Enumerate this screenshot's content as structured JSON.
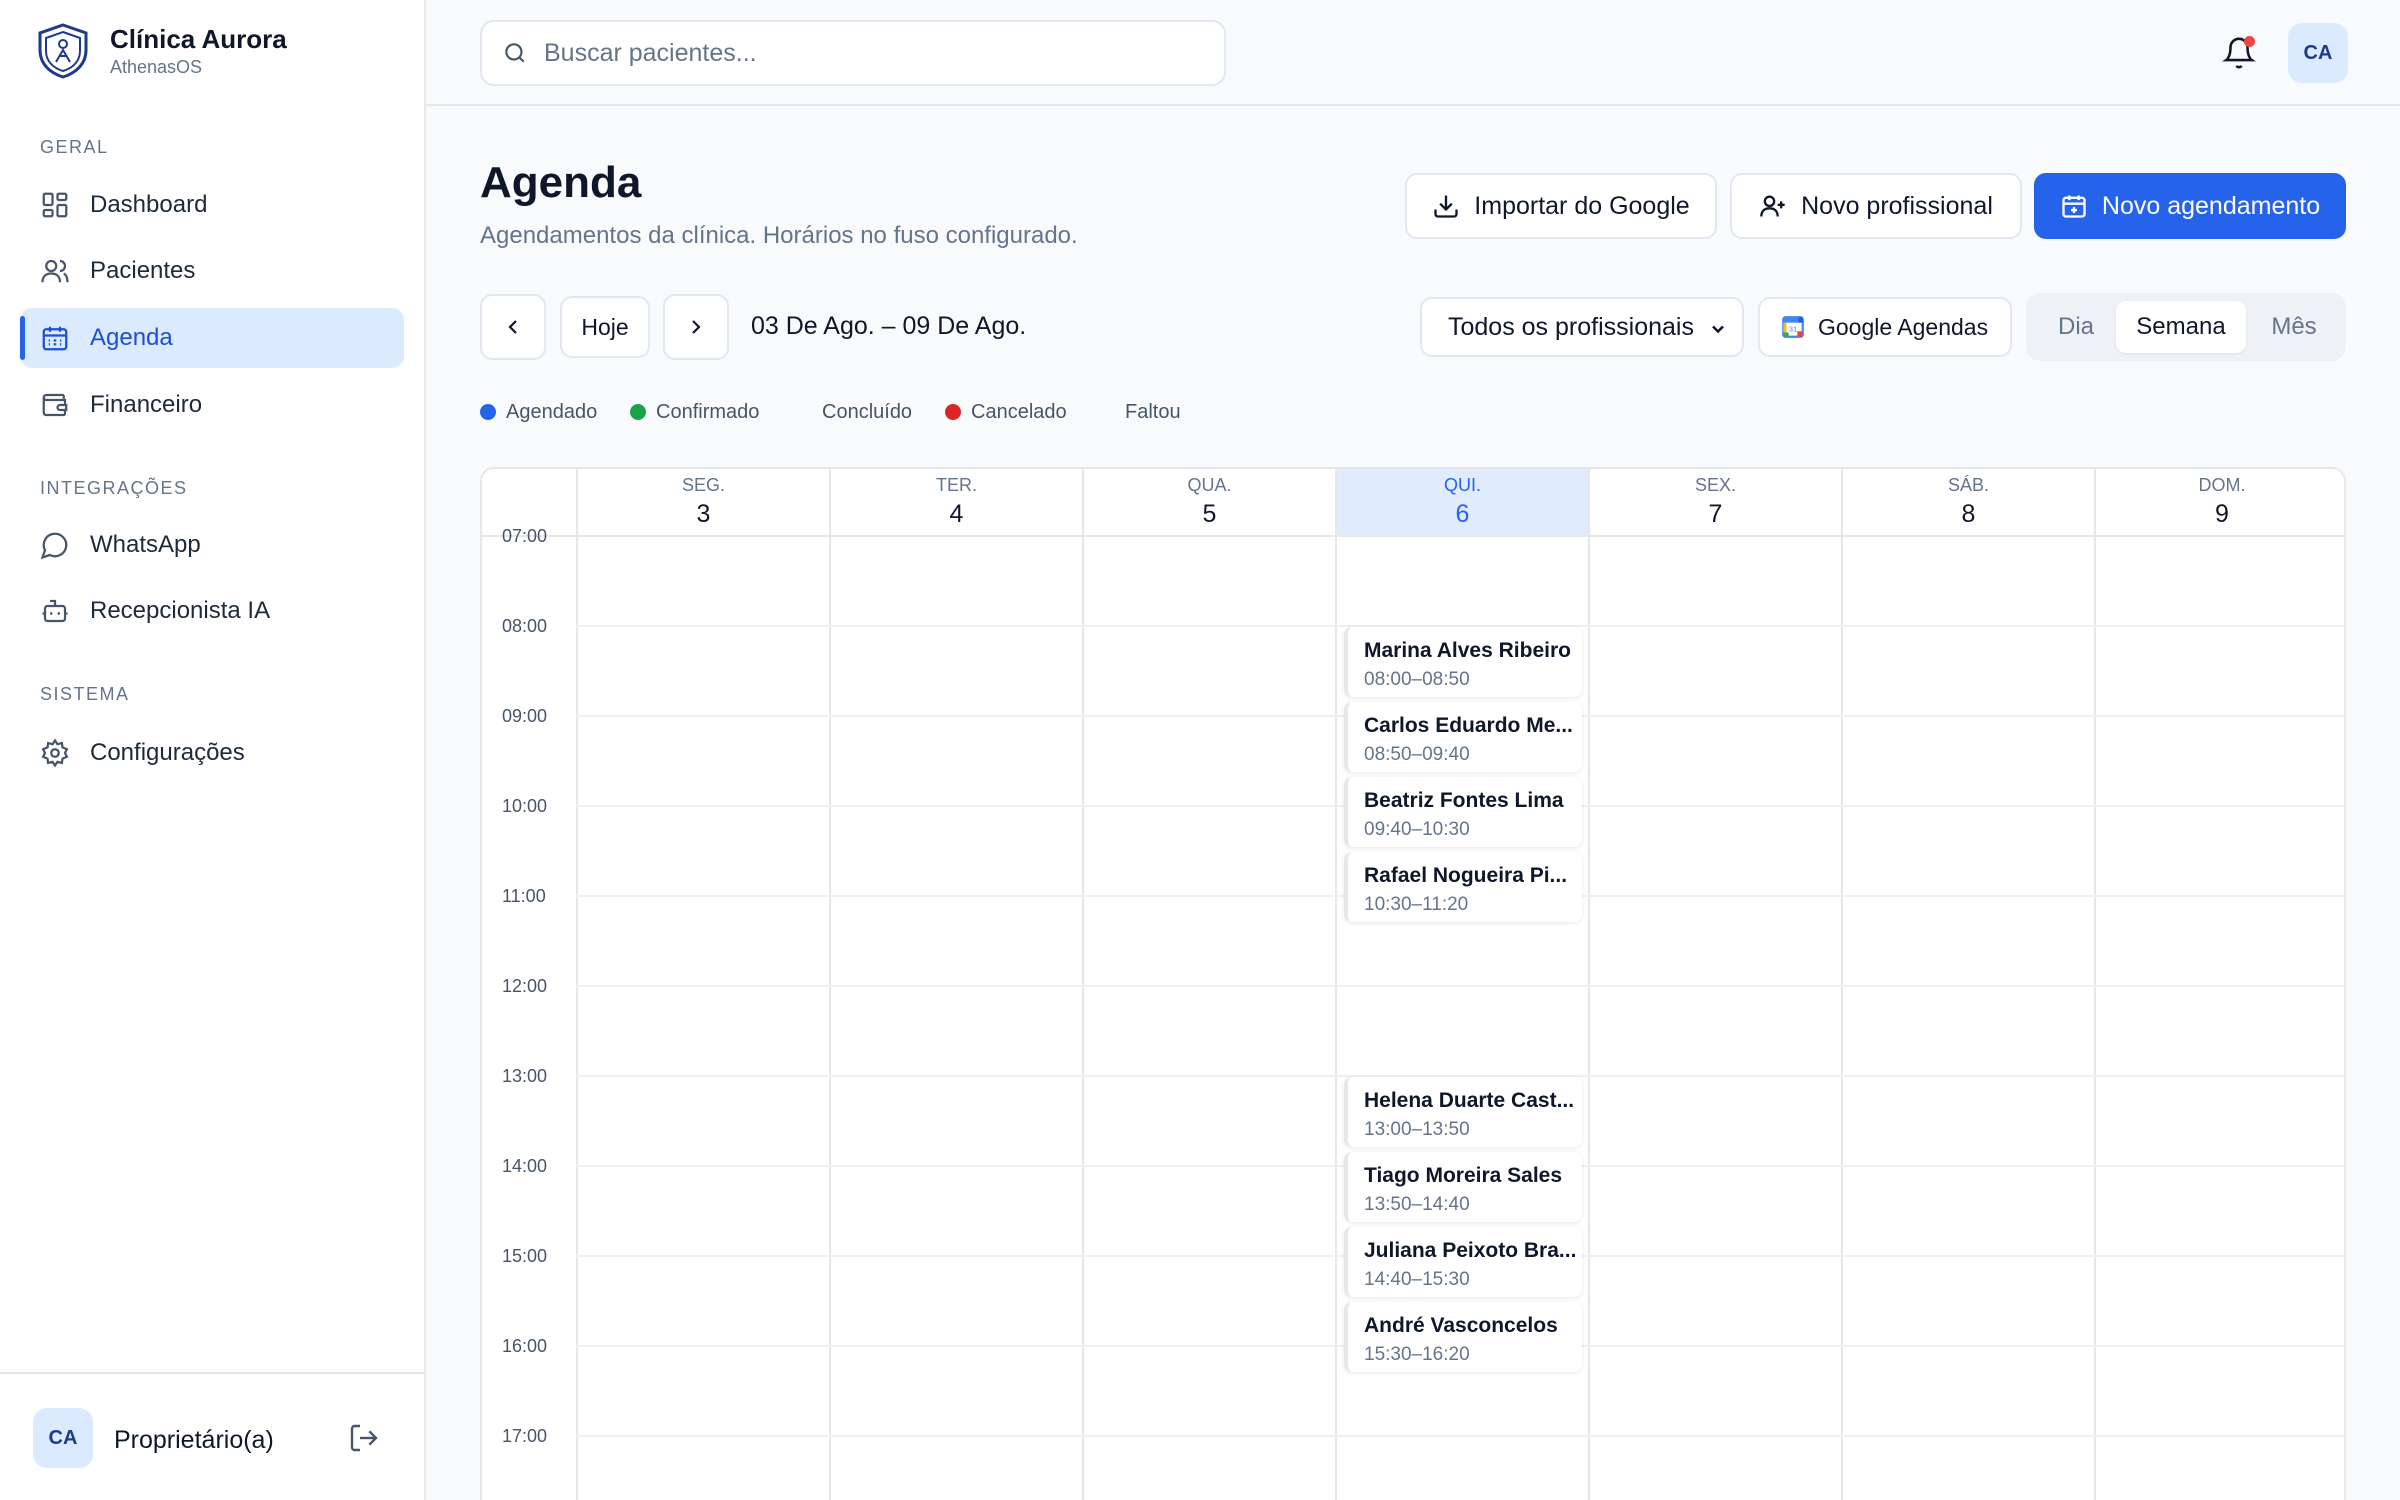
{
  "brand": {
    "name": "Clínica Aurora",
    "sub": "AthenasOS"
  },
  "sidebar": {
    "sections": [
      {
        "title": "GERAL",
        "items": [
          {
            "label": "Dashboard",
            "icon": "dashboard-icon"
          },
          {
            "label": "Pacientes",
            "icon": "users-icon"
          },
          {
            "label": "Agenda",
            "icon": "calendar-icon",
            "active": true
          },
          {
            "label": "Financeiro",
            "icon": "wallet-icon"
          }
        ]
      },
      {
        "title": "INTEGRAÇÕES",
        "items": [
          {
            "label": "WhatsApp",
            "icon": "chat-icon"
          },
          {
            "label": "Recepcionista IA",
            "icon": "bot-icon"
          }
        ]
      },
      {
        "title": "SISTEMA",
        "items": [
          {
            "label": "Configurações",
            "icon": "gear-icon"
          }
        ]
      }
    ],
    "footer": {
      "avatar": "CA",
      "role": "Proprietário(a)"
    }
  },
  "topbar": {
    "search_placeholder": "Buscar pacientes...",
    "avatar": "CA"
  },
  "header": {
    "title": "Agenda",
    "subtitle": "Agendamentos da clínica. Horários no fuso configurado.",
    "import_label": "Importar do Google",
    "new_prof_label": "Novo profissional",
    "new_appt_label": "Novo agendamento"
  },
  "toolbar": {
    "today_label": "Hoje",
    "range": "03 De Ago. – 09 De Ago.",
    "professional_select": "Todos os profissionais",
    "google_label": "Google Agendas",
    "views": [
      "Dia",
      "Semana",
      "Mês"
    ],
    "active_view": "Semana"
  },
  "legend": [
    {
      "label": "Agendado",
      "color": "#2563eb"
    },
    {
      "label": "Confirmado",
      "color": "#16a34a"
    },
    {
      "label": "Concluído",
      "color": ""
    },
    {
      "label": "Cancelado",
      "color": "#dc2626"
    },
    {
      "label": "Faltou",
      "color": ""
    }
  ],
  "calendar": {
    "days": [
      {
        "dow": "SEG.",
        "num": "3"
      },
      {
        "dow": "TER.",
        "num": "4"
      },
      {
        "dow": "QUA.",
        "num": "5"
      },
      {
        "dow": "QUI.",
        "num": "6",
        "today": true
      },
      {
        "dow": "SEX.",
        "num": "7"
      },
      {
        "dow": "SÁB.",
        "num": "8"
      },
      {
        "dow": "DOM.",
        "num": "9"
      }
    ],
    "hours": [
      "07:00",
      "08:00",
      "09:00",
      "10:00",
      "11:00",
      "12:00",
      "13:00",
      "14:00",
      "15:00",
      "16:00",
      "17:00"
    ],
    "appointments": [
      {
        "day": "QUI.",
        "name": "Marina Alves Ribeiro",
        "time": "08:00–08:50"
      },
      {
        "day": "QUI.",
        "name": "Carlos Eduardo Me...",
        "time": "08:50–09:40"
      },
      {
        "day": "QUI.",
        "name": "Beatriz Fontes Lima",
        "time": "09:40–10:30"
      },
      {
        "day": "QUI.",
        "name": "Rafael Nogueira Pi...",
        "time": "10:30–11:20"
      },
      {
        "day": "QUI.",
        "name": "Helena Duarte Cast...",
        "time": "13:00–13:50"
      },
      {
        "day": "QUI.",
        "name": "Tiago Moreira Sales",
        "time": "13:50–14:40"
      },
      {
        "day": "QUI.",
        "name": "Juliana Peixoto Bra...",
        "time": "14:40–15:30"
      },
      {
        "day": "QUI.",
        "name": "André Vasconcelos",
        "time": "15:30–16:20"
      }
    ]
  }
}
